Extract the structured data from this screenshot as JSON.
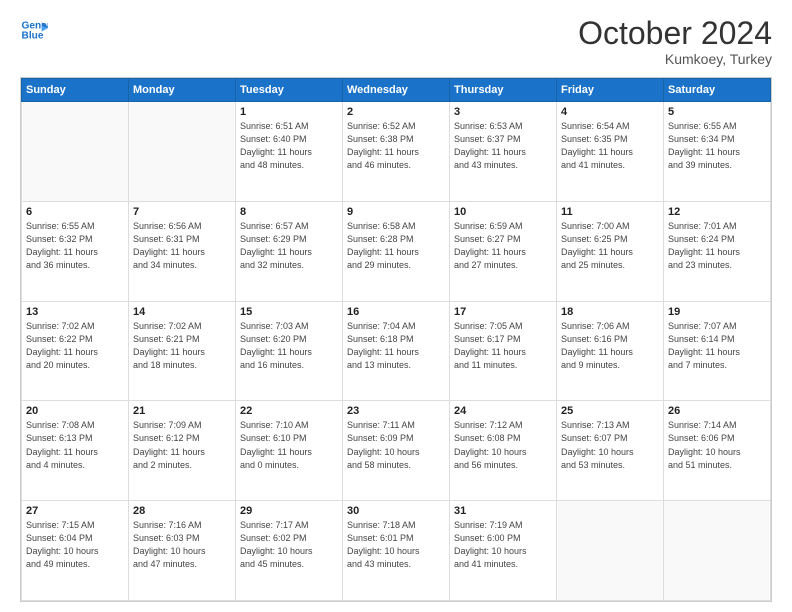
{
  "header": {
    "logo_line1": "General",
    "logo_line2": "Blue",
    "month": "October 2024",
    "location": "Kumkoey, Turkey"
  },
  "weekdays": [
    "Sunday",
    "Monday",
    "Tuesday",
    "Wednesday",
    "Thursday",
    "Friday",
    "Saturday"
  ],
  "weeks": [
    [
      {
        "day": "",
        "info": ""
      },
      {
        "day": "",
        "info": ""
      },
      {
        "day": "1",
        "info": "Sunrise: 6:51 AM\nSunset: 6:40 PM\nDaylight: 11 hours\nand 48 minutes."
      },
      {
        "day": "2",
        "info": "Sunrise: 6:52 AM\nSunset: 6:38 PM\nDaylight: 11 hours\nand 46 minutes."
      },
      {
        "day": "3",
        "info": "Sunrise: 6:53 AM\nSunset: 6:37 PM\nDaylight: 11 hours\nand 43 minutes."
      },
      {
        "day": "4",
        "info": "Sunrise: 6:54 AM\nSunset: 6:35 PM\nDaylight: 11 hours\nand 41 minutes."
      },
      {
        "day": "5",
        "info": "Sunrise: 6:55 AM\nSunset: 6:34 PM\nDaylight: 11 hours\nand 39 minutes."
      }
    ],
    [
      {
        "day": "6",
        "info": "Sunrise: 6:55 AM\nSunset: 6:32 PM\nDaylight: 11 hours\nand 36 minutes."
      },
      {
        "day": "7",
        "info": "Sunrise: 6:56 AM\nSunset: 6:31 PM\nDaylight: 11 hours\nand 34 minutes."
      },
      {
        "day": "8",
        "info": "Sunrise: 6:57 AM\nSunset: 6:29 PM\nDaylight: 11 hours\nand 32 minutes."
      },
      {
        "day": "9",
        "info": "Sunrise: 6:58 AM\nSunset: 6:28 PM\nDaylight: 11 hours\nand 29 minutes."
      },
      {
        "day": "10",
        "info": "Sunrise: 6:59 AM\nSunset: 6:27 PM\nDaylight: 11 hours\nand 27 minutes."
      },
      {
        "day": "11",
        "info": "Sunrise: 7:00 AM\nSunset: 6:25 PM\nDaylight: 11 hours\nand 25 minutes."
      },
      {
        "day": "12",
        "info": "Sunrise: 7:01 AM\nSunset: 6:24 PM\nDaylight: 11 hours\nand 23 minutes."
      }
    ],
    [
      {
        "day": "13",
        "info": "Sunrise: 7:02 AM\nSunset: 6:22 PM\nDaylight: 11 hours\nand 20 minutes."
      },
      {
        "day": "14",
        "info": "Sunrise: 7:02 AM\nSunset: 6:21 PM\nDaylight: 11 hours\nand 18 minutes."
      },
      {
        "day": "15",
        "info": "Sunrise: 7:03 AM\nSunset: 6:20 PM\nDaylight: 11 hours\nand 16 minutes."
      },
      {
        "day": "16",
        "info": "Sunrise: 7:04 AM\nSunset: 6:18 PM\nDaylight: 11 hours\nand 13 minutes."
      },
      {
        "day": "17",
        "info": "Sunrise: 7:05 AM\nSunset: 6:17 PM\nDaylight: 11 hours\nand 11 minutes."
      },
      {
        "day": "18",
        "info": "Sunrise: 7:06 AM\nSunset: 6:16 PM\nDaylight: 11 hours\nand 9 minutes."
      },
      {
        "day": "19",
        "info": "Sunrise: 7:07 AM\nSunset: 6:14 PM\nDaylight: 11 hours\nand 7 minutes."
      }
    ],
    [
      {
        "day": "20",
        "info": "Sunrise: 7:08 AM\nSunset: 6:13 PM\nDaylight: 11 hours\nand 4 minutes."
      },
      {
        "day": "21",
        "info": "Sunrise: 7:09 AM\nSunset: 6:12 PM\nDaylight: 11 hours\nand 2 minutes."
      },
      {
        "day": "22",
        "info": "Sunrise: 7:10 AM\nSunset: 6:10 PM\nDaylight: 11 hours\nand 0 minutes."
      },
      {
        "day": "23",
        "info": "Sunrise: 7:11 AM\nSunset: 6:09 PM\nDaylight: 10 hours\nand 58 minutes."
      },
      {
        "day": "24",
        "info": "Sunrise: 7:12 AM\nSunset: 6:08 PM\nDaylight: 10 hours\nand 56 minutes."
      },
      {
        "day": "25",
        "info": "Sunrise: 7:13 AM\nSunset: 6:07 PM\nDaylight: 10 hours\nand 53 minutes."
      },
      {
        "day": "26",
        "info": "Sunrise: 7:14 AM\nSunset: 6:06 PM\nDaylight: 10 hours\nand 51 minutes."
      }
    ],
    [
      {
        "day": "27",
        "info": "Sunrise: 7:15 AM\nSunset: 6:04 PM\nDaylight: 10 hours\nand 49 minutes."
      },
      {
        "day": "28",
        "info": "Sunrise: 7:16 AM\nSunset: 6:03 PM\nDaylight: 10 hours\nand 47 minutes."
      },
      {
        "day": "29",
        "info": "Sunrise: 7:17 AM\nSunset: 6:02 PM\nDaylight: 10 hours\nand 45 minutes."
      },
      {
        "day": "30",
        "info": "Sunrise: 7:18 AM\nSunset: 6:01 PM\nDaylight: 10 hours\nand 43 minutes."
      },
      {
        "day": "31",
        "info": "Sunrise: 7:19 AM\nSunset: 6:00 PM\nDaylight: 10 hours\nand 41 minutes."
      },
      {
        "day": "",
        "info": ""
      },
      {
        "day": "",
        "info": ""
      }
    ]
  ]
}
